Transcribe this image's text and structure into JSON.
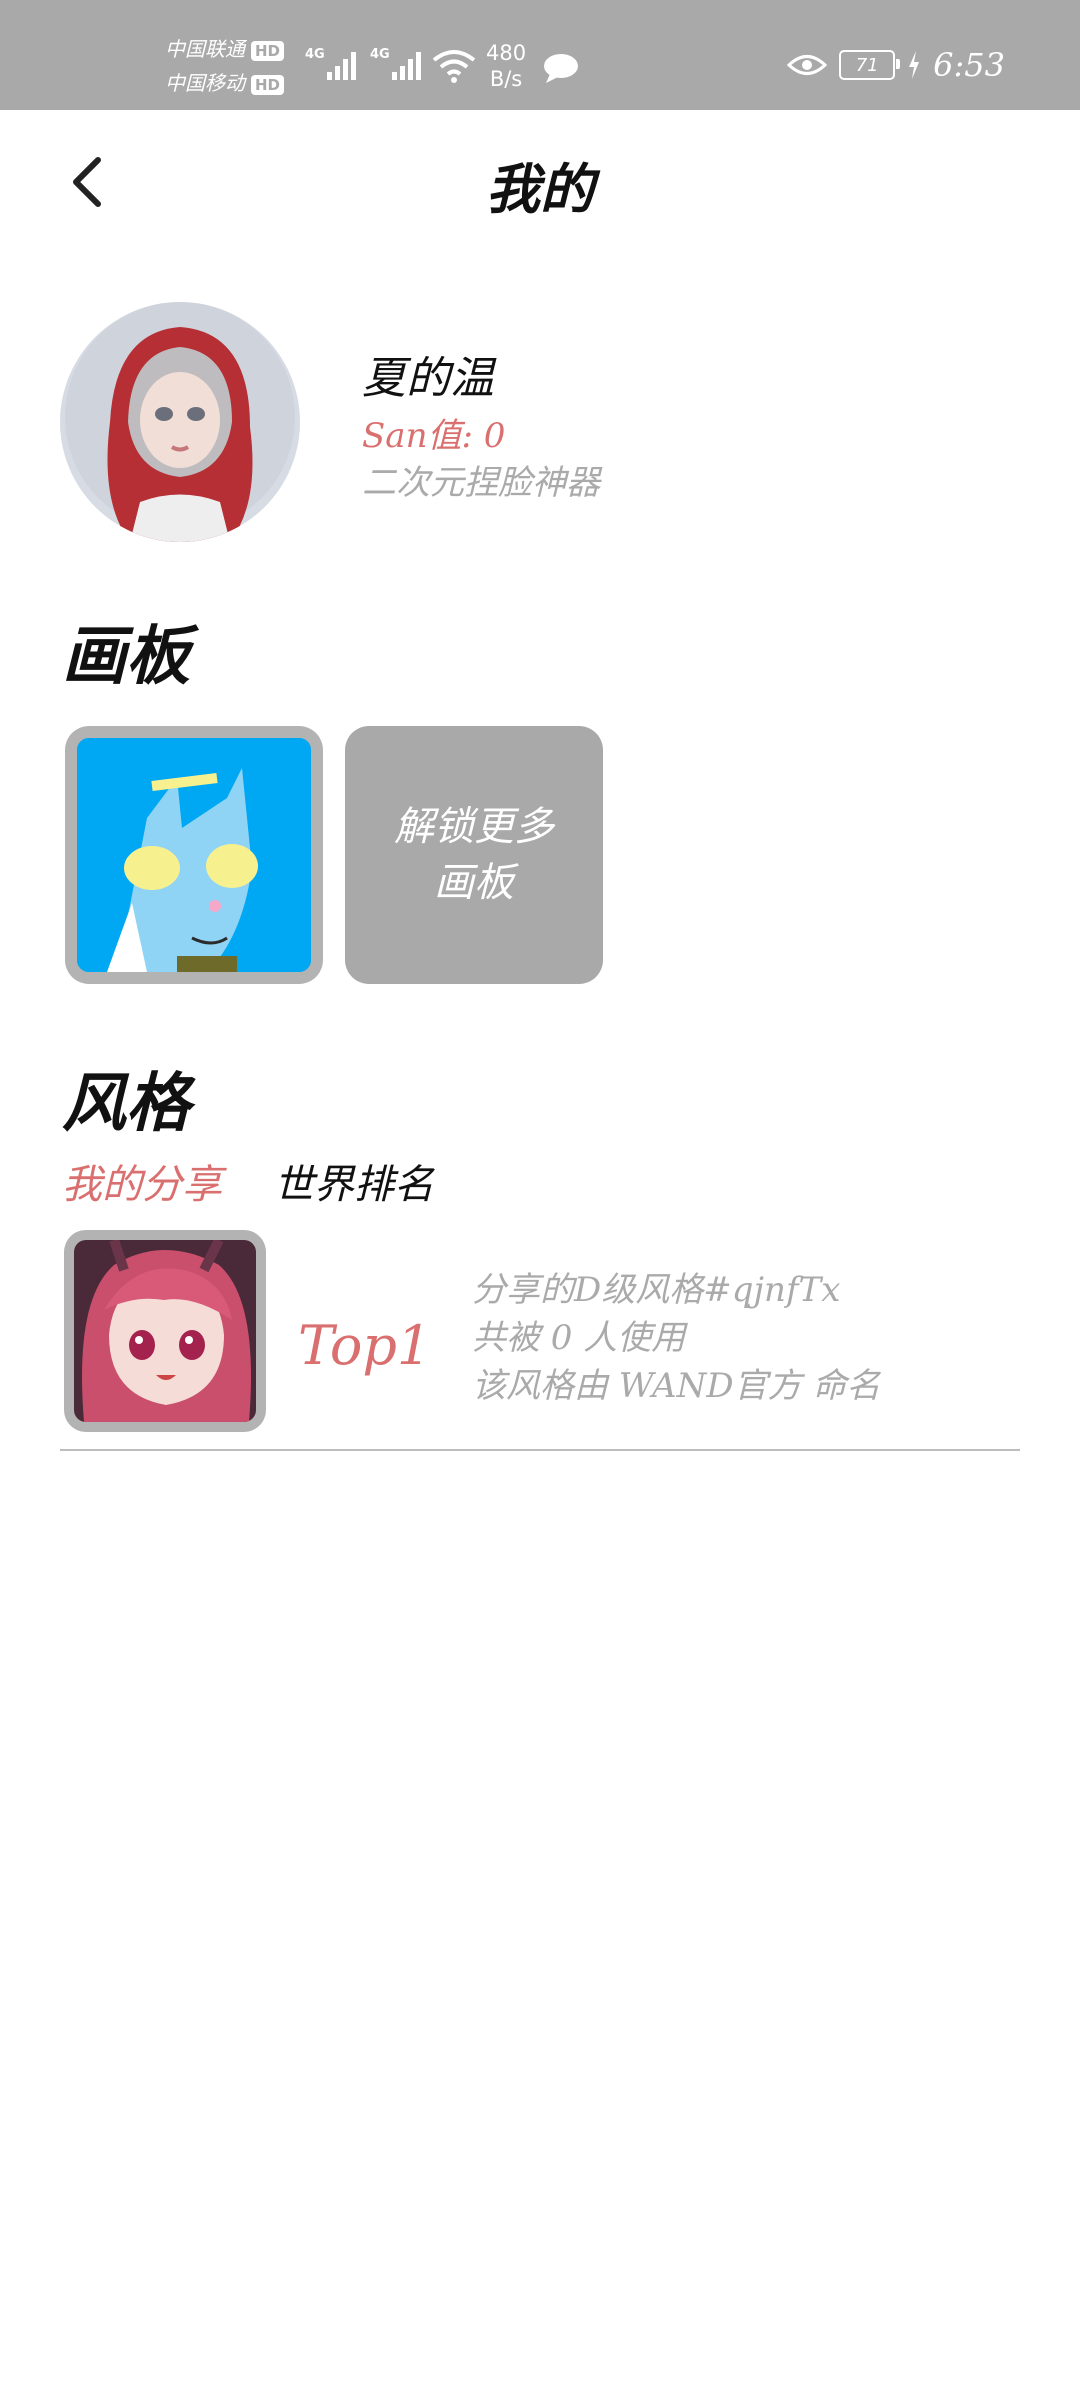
{
  "status_bar": {
    "carrier1": "中国联通",
    "carrier2": "中国移动",
    "hd_badge": "HD",
    "network_type": "4G",
    "speed_value": "480",
    "speed_unit": "B/s",
    "battery_level": "71",
    "time": "6:53"
  },
  "header": {
    "title": "我的"
  },
  "profile": {
    "username": "夏的温",
    "san_label": "San值:",
    "san_value": "0",
    "bio": "二次元捏脸神器"
  },
  "boards": {
    "section_title": "画板",
    "unlock_label": "解锁更多画板"
  },
  "styles": {
    "section_title": "风格",
    "tabs": [
      "我的分享",
      "世界排名"
    ],
    "items": [
      {
        "rank": "Top1",
        "line1": "分享的D级风格#qjnfTx",
        "line2": "共被 0 人使用",
        "line3": "该风格由 WAND官方 命名"
      }
    ]
  },
  "colors": {
    "accent": "#d9706f",
    "muted_text": "#aaaaaa",
    "status_bar": "#a9a9a9",
    "card_gray": "#a9a9a9"
  }
}
